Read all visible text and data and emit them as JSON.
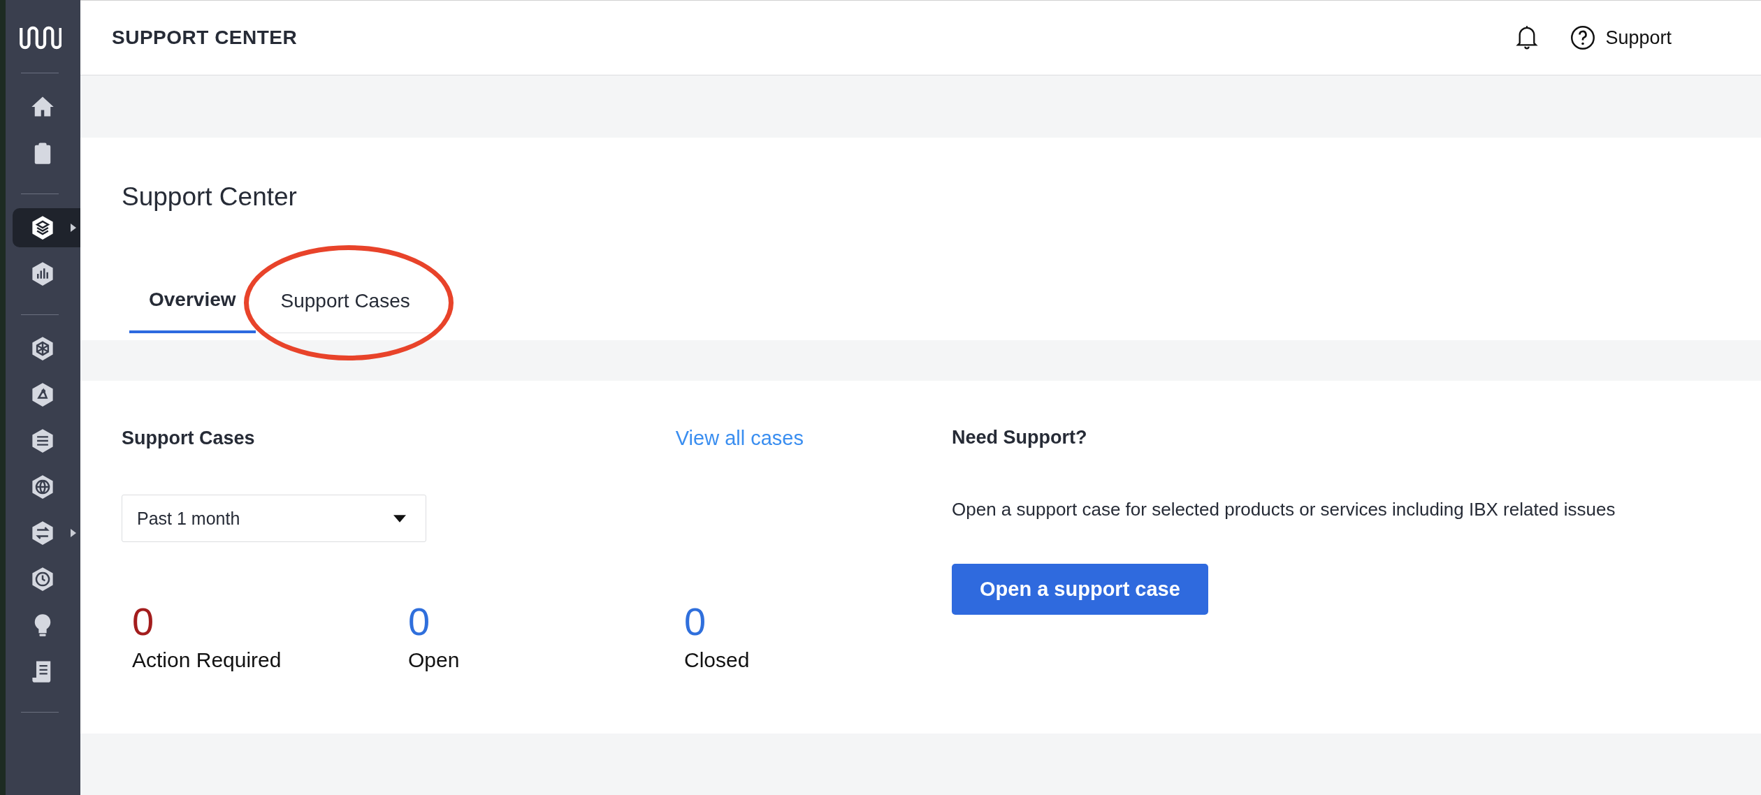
{
  "sidebar": {
    "groups": [
      {
        "items": [
          {
            "selected": false,
            "expandable": false
          },
          {
            "selected": false,
            "expandable": false
          }
        ]
      },
      {
        "items": [
          {
            "selected": true,
            "expandable": true
          },
          {
            "selected": false,
            "expandable": false
          }
        ]
      },
      {
        "items": [
          {
            "selected": false,
            "expandable": false
          },
          {
            "selected": false,
            "expandable": false
          },
          {
            "selected": false,
            "expandable": false
          },
          {
            "selected": false,
            "expandable": false
          },
          {
            "selected": false,
            "expandable": true
          },
          {
            "selected": false,
            "expandable": false
          },
          {
            "selected": false,
            "expandable": false
          },
          {
            "selected": false,
            "expandable": false
          }
        ]
      }
    ]
  },
  "header": {
    "title": "SUPPORT CENTER",
    "support_link": "Support"
  },
  "page": {
    "title": "Support Center"
  },
  "tabs": [
    {
      "label": "Overview",
      "selected": true,
      "circled": false
    },
    {
      "label": "Support Cases",
      "selected": false,
      "circled": true
    }
  ],
  "support_cases": {
    "title": "Support Cases",
    "view_all": "View all cases",
    "period": "Past 1 month",
    "stats": [
      {
        "value": "0",
        "label": "Action Required",
        "color": "#a31d1d"
      },
      {
        "value": "0",
        "label": "Open",
        "color": "#2f6fdc"
      },
      {
        "value": "0",
        "label": "Closed",
        "color": "#2f6fdc"
      }
    ]
  },
  "need_support": {
    "title": "Need Support?",
    "text": "Open a support case for selected products or services including IBX related issues",
    "button": "Open a support case"
  }
}
